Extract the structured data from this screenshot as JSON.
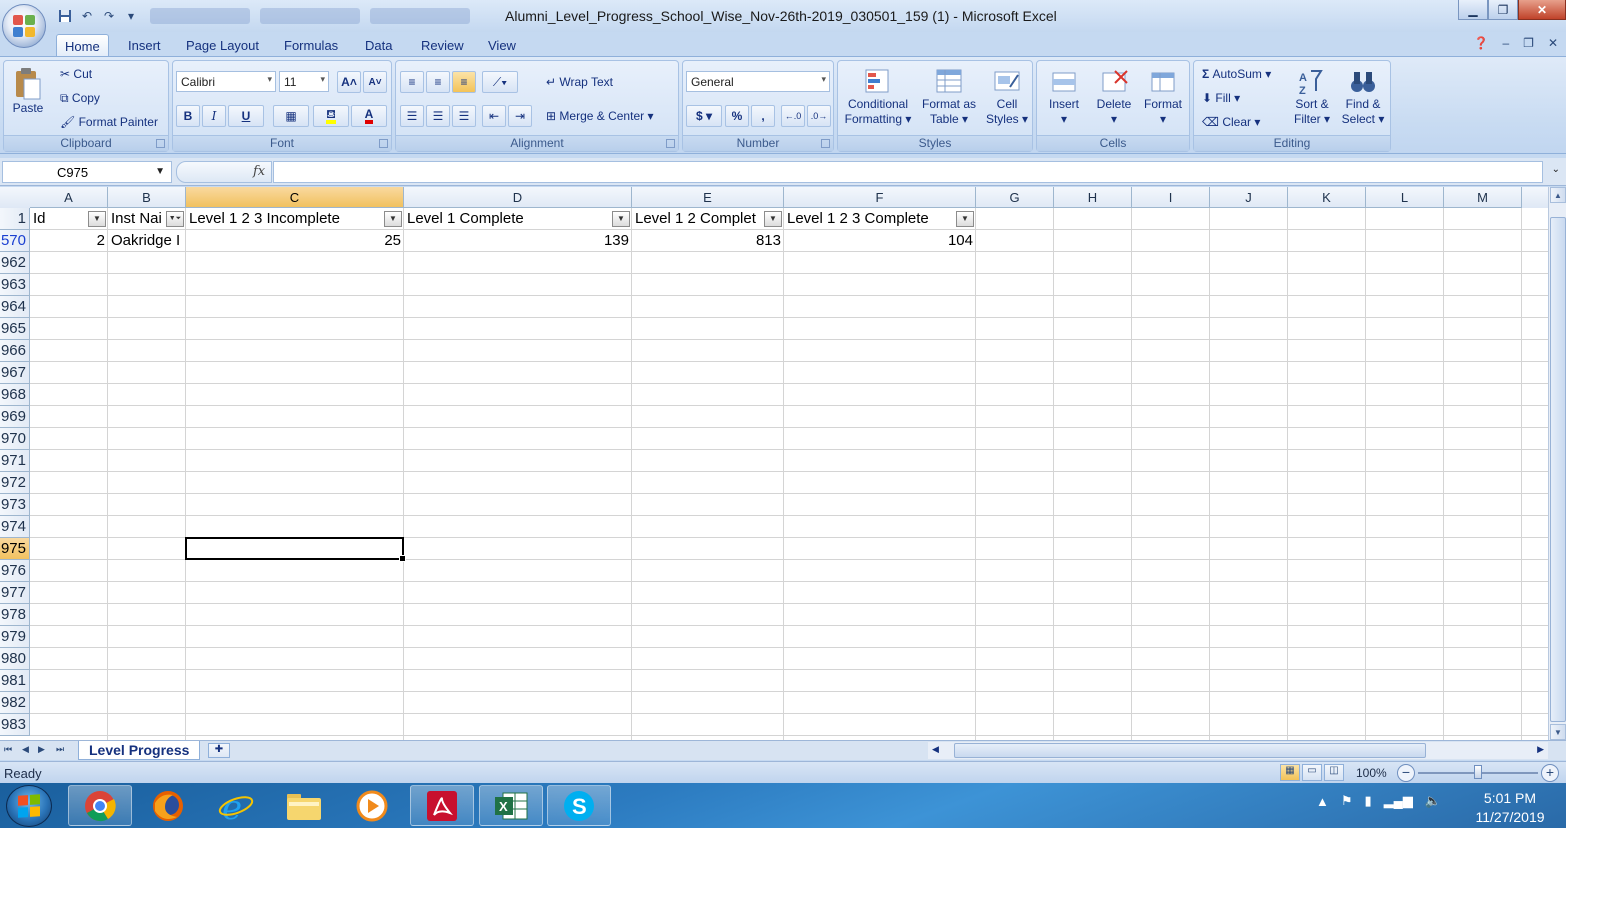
{
  "window": {
    "title": "Alumni_Level_Progress_School_Wise_Nov-26th-2019_030501_159 (1) - Microsoft Excel"
  },
  "tabs": [
    "Home",
    "Insert",
    "Page Layout",
    "Formulas",
    "Data",
    "Review",
    "View"
  ],
  "ribbon": {
    "clipboard": {
      "name": "Clipboard",
      "paste": "Paste",
      "cut": "Cut",
      "copy": "Copy",
      "format_painter": "Format Painter"
    },
    "font": {
      "name": "Font",
      "family": "Calibri",
      "size": "11",
      "bold": "B",
      "italic": "I",
      "underline": "U",
      "grow": "A",
      "shrink": "A"
    },
    "alignment": {
      "name": "Alignment",
      "wrap_text": "Wrap Text",
      "merge_center": "Merge & Center"
    },
    "number": {
      "name": "Number",
      "format": "General",
      "currency": "$",
      "percent": "%",
      "comma": ","
    },
    "styles": {
      "name": "Styles",
      "cond_line1": "Conditional",
      "cond_line2": "Formatting",
      "table_line1": "Format as",
      "table_line2": "Table",
      "cell_line1": "Cell",
      "cell_line2": "Styles"
    },
    "cells": {
      "name": "Cells",
      "insert": "Insert",
      "delete": "Delete",
      "format": "Format"
    },
    "editing": {
      "name": "Editing",
      "autosum": "AutoSum",
      "fill": "Fill",
      "clear": "Clear",
      "sort_line1": "Sort &",
      "sort_line2": "Filter",
      "find_line1": "Find &",
      "find_line2": "Select"
    }
  },
  "formula_bar": {
    "name_box": "C975",
    "fx": "fx",
    "formula": ""
  },
  "grid": {
    "columns": [
      "A",
      "B",
      "C",
      "D",
      "E",
      "F",
      "G",
      "H",
      "I",
      "J",
      "K",
      "L",
      "M"
    ],
    "selected_column": "C",
    "header_row_num": "1",
    "headers": [
      "Id",
      "Inst Nai",
      "Level 1 2 3 Incomplete",
      "Level 1 Complete",
      "Level 1 2 Complet",
      "Level 1 2 3 Complete"
    ],
    "data_row_num": "570",
    "data_row": [
      "2",
      "Oakridge I",
      "25",
      "139",
      "813",
      "104"
    ],
    "rows": [
      "962",
      "963",
      "964",
      "965",
      "966",
      "967",
      "968",
      "969",
      "970",
      "971",
      "972",
      "973",
      "974",
      "975",
      "976",
      "977",
      "978",
      "979",
      "980",
      "981",
      "982",
      "983"
    ],
    "selected_row": "975"
  },
  "sheet": {
    "tab": "Level Progress"
  },
  "status": {
    "ready": "Ready",
    "zoom": "100%"
  },
  "clock": {
    "time": "5:01 PM",
    "date": "11/27/2019"
  },
  "colors": {
    "title_bar": "#c4d8f0",
    "ribbon": "#c8dbf2",
    "selection_header": "#f1c15f",
    "filtered_row": "#1a3fd1",
    "taskbar": "#2c7bc0"
  }
}
